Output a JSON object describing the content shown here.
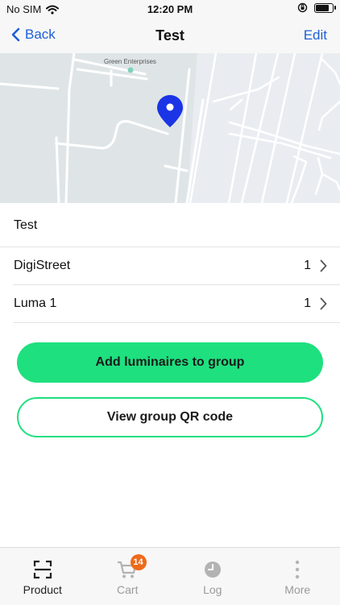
{
  "status_bar": {
    "carrier": "No SIM",
    "time": "12:20 PM",
    "battery_level": 0.9
  },
  "nav": {
    "back_label": "Back",
    "title": "Test",
    "edit_label": "Edit"
  },
  "map": {
    "place_label": "Green Enterprises",
    "pin_color": "#1b34e6"
  },
  "group": {
    "name": "Test"
  },
  "items": [
    {
      "label": "DigiStreet",
      "count": "1"
    },
    {
      "label": "Luma 1",
      "count": "1"
    }
  ],
  "actions": {
    "primary_label": "Add luminaires to group",
    "secondary_label": "View group QR code",
    "accent_color": "#1ee07f"
  },
  "tabs": [
    {
      "label": "Product",
      "icon": "qr-scan-icon",
      "active": true
    },
    {
      "label": "Cart",
      "icon": "cart-icon",
      "badge": "14"
    },
    {
      "label": "Log",
      "icon": "clock-icon"
    },
    {
      "label": "More",
      "icon": "more-vertical-icon"
    }
  ]
}
